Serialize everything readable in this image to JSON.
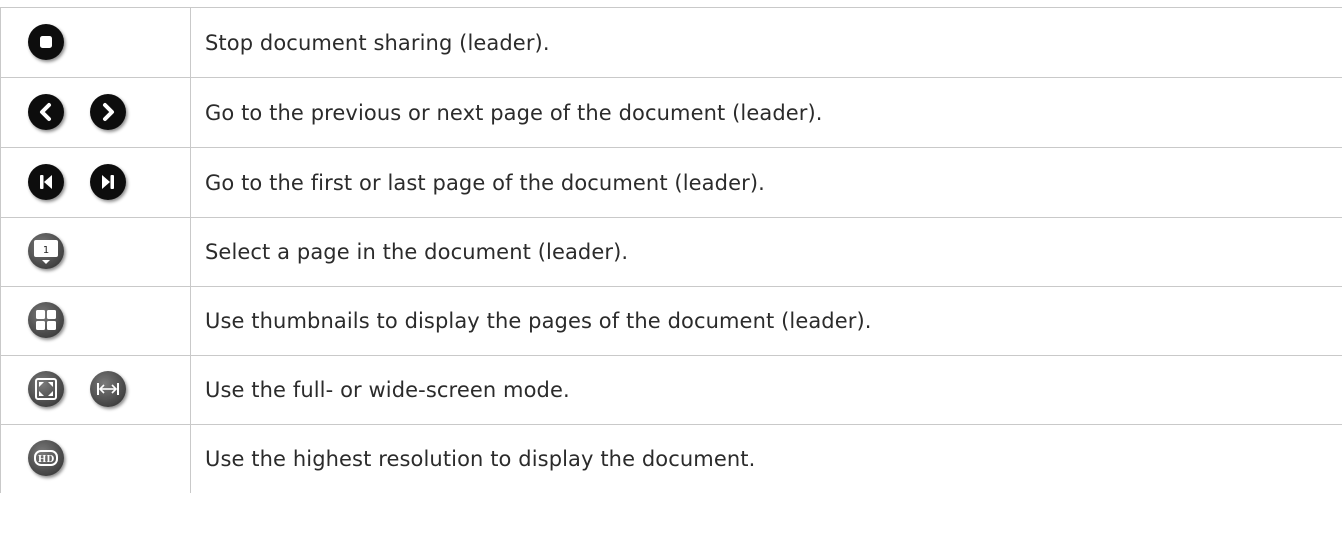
{
  "rows": [
    {
      "icons": [
        "stop-icon"
      ],
      "text": "Stop document sharing (leader)."
    },
    {
      "icons": [
        "previous-page-icon",
        "next-page-icon"
      ],
      "text": "Go to the previous or next page of the document (leader)."
    },
    {
      "icons": [
        "first-page-icon",
        "last-page-icon"
      ],
      "text": "Go to the first or last page of the document (leader)."
    },
    {
      "icons": [
        "page-select-icon"
      ],
      "page_select_number": "1",
      "text": "Select a page in the document (leader)."
    },
    {
      "icons": [
        "thumbnails-icon"
      ],
      "text": "Use thumbnails to display the pages of the document (leader)."
    },
    {
      "icons": [
        "full-screen-icon",
        "wide-screen-icon"
      ],
      "text": "Use the full- or wide-screen mode."
    },
    {
      "icons": [
        "hd-resolution-icon"
      ],
      "hd_label": "HD",
      "text": "Use the highest resolution to display the document."
    }
  ],
  "colors": {
    "border": "#c9c9c9",
    "text": "#2b2b2b",
    "icon_dark": "#111111",
    "icon_gray": "#4a4a4a"
  }
}
